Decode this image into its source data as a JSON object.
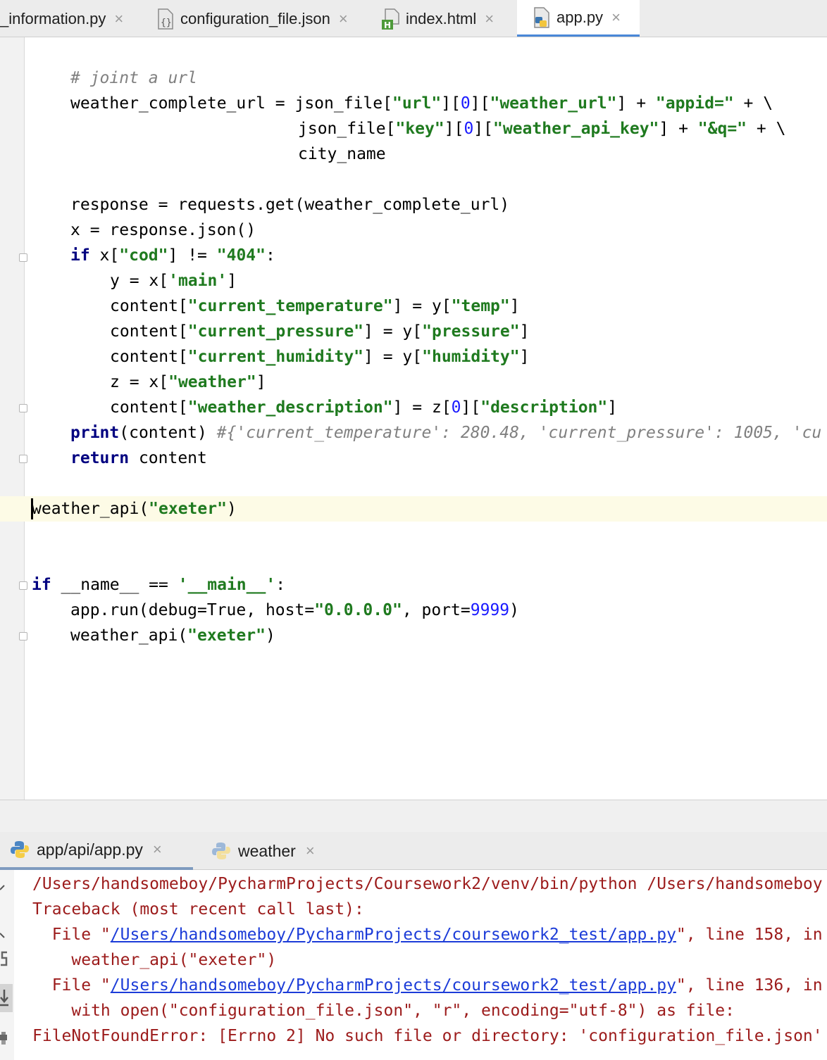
{
  "editor_tabs": [
    {
      "label": "_information.py",
      "active": false
    },
    {
      "label": "configuration_file.json",
      "active": false
    },
    {
      "label": "index.html",
      "active": false
    },
    {
      "label": "app.py",
      "active": true
    }
  ],
  "code": {
    "l1": "# joint a url",
    "l2a": "weather_complete_url = json_file[",
    "l2b": "\"url\"",
    "l2c": "][",
    "l2d": "0",
    "l2e": "][",
    "l2f": "\"weather_url\"",
    "l2g": "] + ",
    "l2h": "\"appid=\"",
    "l2i": " + \\",
    "l3a": "json_file[",
    "l3b": "\"key\"",
    "l3c": "][",
    "l3d": "0",
    "l3e": "][",
    "l3f": "\"weather_api_key\"",
    "l3g": "] + ",
    "l3h": "\"&q=\"",
    "l3i": " + \\",
    "l4": "city_name",
    "l5": "response = requests.get(weather_complete_url)",
    "l6": "x = response.json()",
    "l7a": "if",
    "l7b": " x[",
    "l7c": "\"cod\"",
    "l7d": "] != ",
    "l7e": "\"404\"",
    "l7f": ":",
    "l8a": "y = x[",
    "l8b": "'main'",
    "l8c": "]",
    "l9a": "content[",
    "l9b": "\"current_temperature\"",
    "l9c": "] = y[",
    "l9d": "\"temp\"",
    "l9e": "]",
    "l10a": "content[",
    "l10b": "\"current_pressure\"",
    "l10c": "] = y[",
    "l10d": "\"pressure\"",
    "l10e": "]",
    "l11a": "content[",
    "l11b": "\"current_humidity\"",
    "l11c": "] = y[",
    "l11d": "\"humidity\"",
    "l11e": "]",
    "l12a": "z = x[",
    "l12b": "\"weather\"",
    "l12c": "]",
    "l13a": "content[",
    "l13b": "\"weather_description\"",
    "l13c": "] = z[",
    "l13d": "0",
    "l13e": "][",
    "l13f": "\"description\"",
    "l13g": "]",
    "l14a": "print",
    "l14b": "(content) ",
    "l14c": "#{'current_temperature': 280.48, 'current_pressure': 1005, 'cu",
    "l15a": "return",
    "l15b": " content",
    "l16a": "weather_api(",
    "l16b": "\"exeter\"",
    "l16c": ")",
    "l17a": "if",
    "l17b": " __name__ == ",
    "l17c": "'__main__'",
    "l17d": ":",
    "l18a": "app.run(debug=True, host=",
    "l18b": "\"0.0.0.0\"",
    "l18c": ", port=",
    "l18d": "9999",
    "l18e": ")",
    "l19a": "weather_api(",
    "l19b": "\"exeter\"",
    "l19c": ")"
  },
  "run_tabs": [
    {
      "label": "app/api/app.py",
      "active": true
    },
    {
      "label": "weather",
      "active": false
    }
  ],
  "console": {
    "o1": "/Users/handsomeboy/PycharmProjects/Coursework2/venv/bin/python /Users/handsomeboy",
    "o2": "Traceback (most recent call last):",
    "o3a": "  File \"",
    "o3b": "/Users/handsomeboy/PycharmProjects/coursework2_test/app.py",
    "o3c": "\", line 158, in",
    "o4": "    weather_api(\"exeter\")",
    "o5a": "  File \"",
    "o5b": "/Users/handsomeboy/PycharmProjects/coursework2_test/app.py",
    "o5c": "\", line 136, in",
    "o6": "    with open(\"configuration_file.json\", \"r\", encoding=\"utf-8\") as file:",
    "o7": "FileNotFoundError: [Errno 2] No such file or directory: 'configuration_file.json'"
  },
  "icons": {
    "close": "×",
    "editor_tab_icons": [
      "python-file-icon",
      "json-file-icon",
      "html-file-icon",
      "python-file-icon"
    ]
  }
}
